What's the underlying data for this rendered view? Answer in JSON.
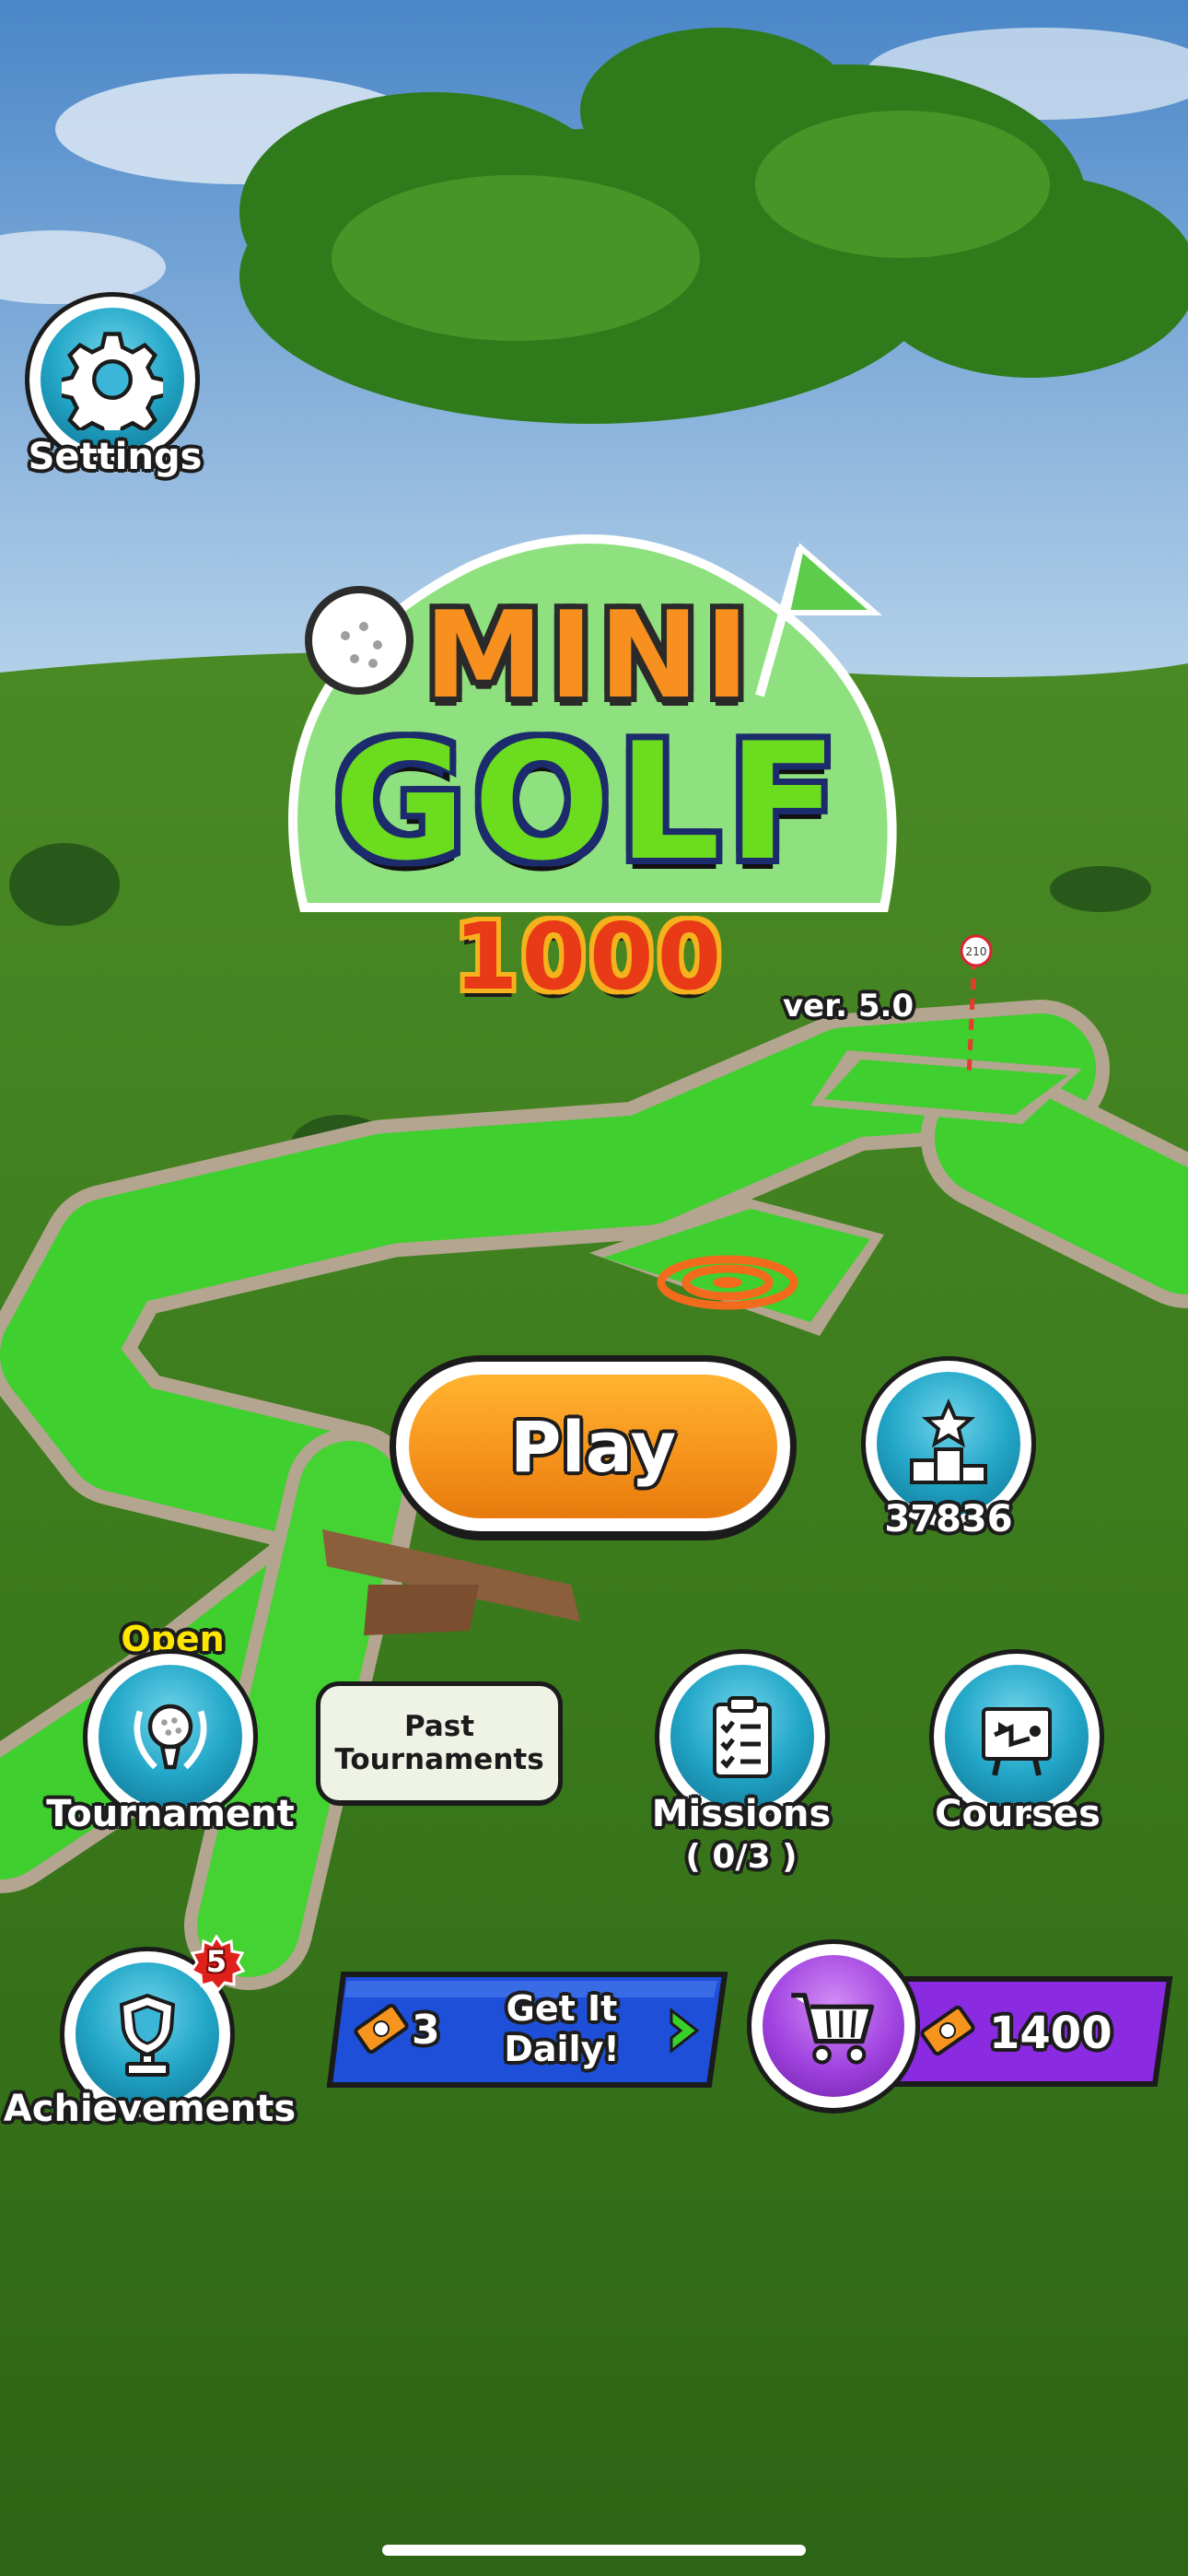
{
  "settings": {
    "label": "Settings"
  },
  "logo": {
    "line1": "MINI",
    "line2": "GOLF",
    "line3": "1000",
    "version": "ver. 5.0"
  },
  "flag_number": "210",
  "play": {
    "label": "Play"
  },
  "leaderboard": {
    "score": "37836"
  },
  "tournament": {
    "status": "Open",
    "label": "Tournament"
  },
  "past_tournaments": {
    "label_line1": "Past",
    "label_line2": "Tournaments"
  },
  "missions": {
    "label": "Missions",
    "progress": "( 0/3 )"
  },
  "courses": {
    "label": "Courses"
  },
  "achievements": {
    "label": "Achievements",
    "badge": "5"
  },
  "daily": {
    "tickets": "3",
    "label_line1": "Get It",
    "label_line2": "Daily!"
  },
  "shop": {
    "tickets": "1400"
  },
  "colors": {
    "play_orange": "#f7941d",
    "daily_blue": "#1e4fd8",
    "shop_purple": "#8a2be2",
    "badge_red": "#e0201b",
    "open_yellow": "#ffe600"
  }
}
